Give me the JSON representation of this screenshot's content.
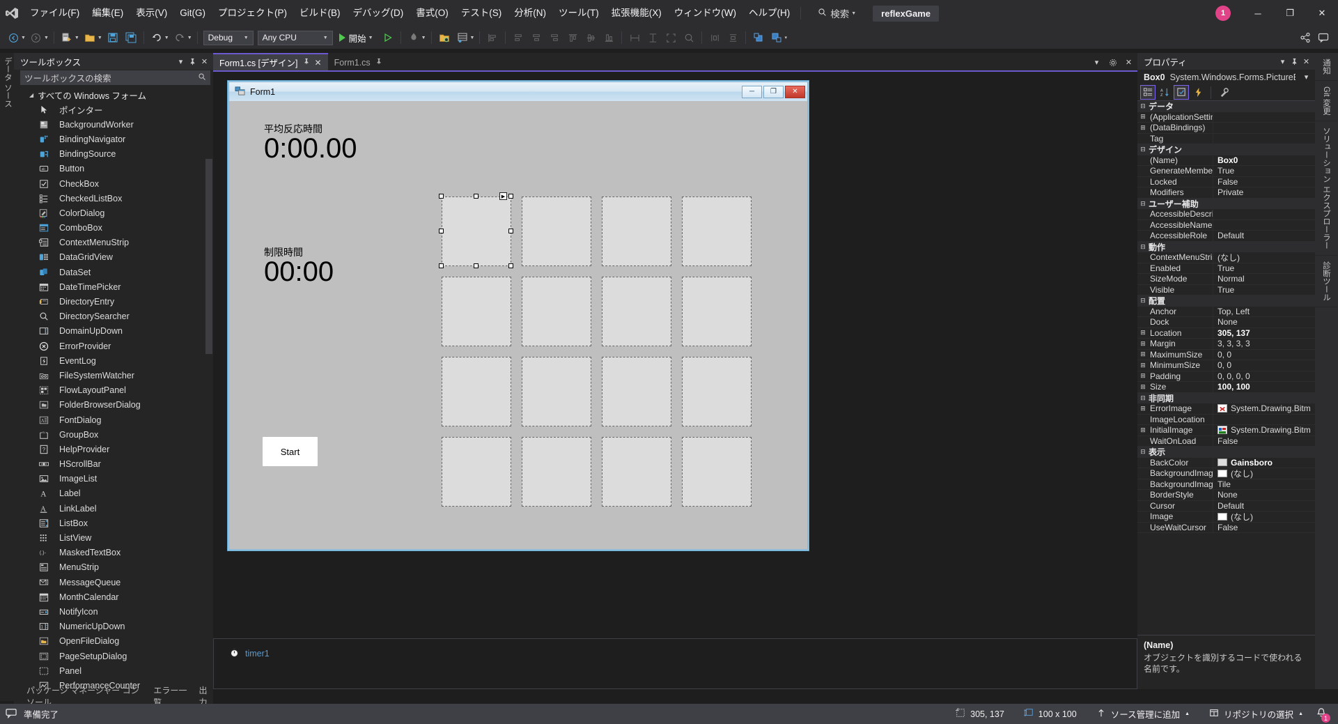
{
  "titlebar": {
    "logo_icon": "visual-studio-logo-icon",
    "menus": [
      "ファイル(F)",
      "編集(E)",
      "表示(V)",
      "Git(G)",
      "プロジェクト(P)",
      "ビルド(B)",
      "デバッグ(D)",
      "書式(O)",
      "テスト(S)",
      "分析(N)",
      "ツール(T)",
      "拡張機能(X)",
      "ウィンドウ(W)",
      "ヘルプ(H)"
    ],
    "search_label": "検索",
    "search_icon": "search-icon",
    "project_chip": "reflexGame",
    "notification_count": "1",
    "minimize_label": "─",
    "maximize_label": "❐",
    "close_label": "✕"
  },
  "toolbar": {
    "configuration": "Debug",
    "platform": "Any CPU",
    "run_label": "開始",
    "icons": [
      "back-navigate-icon",
      "forward-navigate-icon",
      "new-project-icon",
      "open-file-icon",
      "save-icon",
      "save-all-icon",
      "undo-icon",
      "redo-icon",
      "start-debug-icon",
      "attach-process-icon",
      "hot-reload-icon",
      "solution-explorer-icon",
      "properties-window-icon"
    ]
  },
  "left_vertical_tabs": [
    "データ ソース"
  ],
  "toolbox": {
    "title": "ツールボックス",
    "dropdown_icon": "chevron-down-icon",
    "pin_icon": "pin-icon",
    "close_icon": "close-icon",
    "search_placeholder": "ツールボックスの検索",
    "search_icon": "search-icon",
    "group_label": "すべての Windows フォーム",
    "group_expander": "▲",
    "items": [
      {
        "label": "ポインター",
        "icon": "pointer-icon"
      },
      {
        "label": "BackgroundWorker",
        "icon": "background-worker-icon"
      },
      {
        "label": "BindingNavigator",
        "icon": "binding-navigator-icon"
      },
      {
        "label": "BindingSource",
        "icon": "binding-source-icon"
      },
      {
        "label": "Button",
        "icon": "button-icon"
      },
      {
        "label": "CheckBox",
        "icon": "checkbox-icon"
      },
      {
        "label": "CheckedListBox",
        "icon": "checked-list-box-icon"
      },
      {
        "label": "ColorDialog",
        "icon": "color-dialog-icon"
      },
      {
        "label": "ComboBox",
        "icon": "combo-box-icon"
      },
      {
        "label": "ContextMenuStrip",
        "icon": "context-menu-strip-icon"
      },
      {
        "label": "DataGridView",
        "icon": "data-grid-view-icon"
      },
      {
        "label": "DataSet",
        "icon": "data-set-icon"
      },
      {
        "label": "DateTimePicker",
        "icon": "date-time-picker-icon"
      },
      {
        "label": "DirectoryEntry",
        "icon": "directory-entry-icon"
      },
      {
        "label": "DirectorySearcher",
        "icon": "directory-searcher-icon"
      },
      {
        "label": "DomainUpDown",
        "icon": "domain-up-down-icon"
      },
      {
        "label": "ErrorProvider",
        "icon": "error-provider-icon"
      },
      {
        "label": "EventLog",
        "icon": "event-log-icon"
      },
      {
        "label": "FileSystemWatcher",
        "icon": "file-system-watcher-icon"
      },
      {
        "label": "FlowLayoutPanel",
        "icon": "flow-layout-panel-icon"
      },
      {
        "label": "FolderBrowserDialog",
        "icon": "folder-browser-dialog-icon"
      },
      {
        "label": "FontDialog",
        "icon": "font-dialog-icon"
      },
      {
        "label": "GroupBox",
        "icon": "group-box-icon"
      },
      {
        "label": "HelpProvider",
        "icon": "help-provider-icon"
      },
      {
        "label": "HScrollBar",
        "icon": "h-scroll-bar-icon"
      },
      {
        "label": "ImageList",
        "icon": "image-list-icon"
      },
      {
        "label": "Label",
        "icon": "label-icon"
      },
      {
        "label": "LinkLabel",
        "icon": "link-label-icon"
      },
      {
        "label": "ListBox",
        "icon": "list-box-icon"
      },
      {
        "label": "ListView",
        "icon": "list-view-icon"
      },
      {
        "label": "MaskedTextBox",
        "icon": "masked-text-box-icon"
      },
      {
        "label": "MenuStrip",
        "icon": "menu-strip-icon"
      },
      {
        "label": "MessageQueue",
        "icon": "message-queue-icon"
      },
      {
        "label": "MonthCalendar",
        "icon": "month-calendar-icon"
      },
      {
        "label": "NotifyIcon",
        "icon": "notify-icon-icon"
      },
      {
        "label": "NumericUpDown",
        "icon": "numeric-up-down-icon"
      },
      {
        "label": "OpenFileDialog",
        "icon": "open-file-dialog-icon"
      },
      {
        "label": "PageSetupDialog",
        "icon": "page-setup-dialog-icon"
      },
      {
        "label": "Panel",
        "icon": "panel-icon"
      },
      {
        "label": "PerformanceCounter",
        "icon": "performance-counter-icon"
      }
    ],
    "bottom_tabs": [
      "パッケージ マネージャー コンソール",
      "エラー一覧",
      "出力"
    ]
  },
  "document_tabs": [
    {
      "label": "Form1.cs [デザイン]",
      "active": true,
      "pin_icon": "pin-icon",
      "close_icon": "close-icon"
    },
    {
      "label": "Form1.cs",
      "active": false,
      "pin_icon": "pin-icon",
      "close_icon": ""
    }
  ],
  "designer": {
    "form": {
      "title": "Form1",
      "icon": "form-icon",
      "minimize_label": "─",
      "maximize_label": "❐",
      "close_label": "✕",
      "labels": [
        {
          "name": "avg-reaction-caption",
          "text": "平均反応時間"
        },
        {
          "name": "avg-reaction-value",
          "text": "0:00.00"
        },
        {
          "name": "time-limit-caption",
          "text": "制限時間"
        },
        {
          "name": "time-limit-value",
          "text": "00:00"
        }
      ],
      "start_button": "Start",
      "grid_rows": 4,
      "grid_cols": 4,
      "selected_box": "Box0"
    }
  },
  "tray": {
    "items": [
      {
        "label": "timer1",
        "icon": "timer-icon"
      }
    ]
  },
  "properties": {
    "title": "プロパティ",
    "dropdown_icon": "chevron-down-icon",
    "pin_icon": "pin-icon",
    "close_icon": "close-icon",
    "object_name": "Box0",
    "object_type": "System.Windows.Forms.PictureBox",
    "object_dropdown_icon": "chevron-down-icon",
    "toolbar_icons": [
      "categorized-view-icon",
      "alphabetical-view-icon",
      "properties-page-icon",
      "events-icon",
      "property-pages-icon"
    ],
    "rows": [
      {
        "kind": "cat",
        "name": "データ"
      },
      {
        "kind": "prop",
        "exp": "+",
        "name": "(ApplicationSettings",
        "value": ""
      },
      {
        "kind": "prop",
        "exp": "+",
        "name": "(DataBindings)",
        "value": ""
      },
      {
        "kind": "prop",
        "exp": "",
        "name": "Tag",
        "value": ""
      },
      {
        "kind": "cat",
        "name": "デザイン"
      },
      {
        "kind": "prop",
        "exp": "",
        "name": "(Name)",
        "value": "Box0",
        "bold": true
      },
      {
        "kind": "prop",
        "exp": "",
        "name": "GenerateMember",
        "value": "True"
      },
      {
        "kind": "prop",
        "exp": "",
        "name": "Locked",
        "value": "False"
      },
      {
        "kind": "prop",
        "exp": "",
        "name": "Modifiers",
        "value": "Private"
      },
      {
        "kind": "cat",
        "name": "ユーザー補助"
      },
      {
        "kind": "prop",
        "exp": "",
        "name": "AccessibleDescriptio",
        "value": ""
      },
      {
        "kind": "prop",
        "exp": "",
        "name": "AccessibleName",
        "value": ""
      },
      {
        "kind": "prop",
        "exp": "",
        "name": "AccessibleRole",
        "value": "Default"
      },
      {
        "kind": "cat",
        "name": "動作"
      },
      {
        "kind": "prop",
        "exp": "",
        "name": "ContextMenuStrip",
        "value": "(なし)"
      },
      {
        "kind": "prop",
        "exp": "",
        "name": "Enabled",
        "value": "True"
      },
      {
        "kind": "prop",
        "exp": "",
        "name": "SizeMode",
        "value": "Normal"
      },
      {
        "kind": "prop",
        "exp": "",
        "name": "Visible",
        "value": "True"
      },
      {
        "kind": "cat",
        "name": "配置"
      },
      {
        "kind": "prop",
        "exp": "",
        "name": "Anchor",
        "value": "Top, Left"
      },
      {
        "kind": "prop",
        "exp": "",
        "name": "Dock",
        "value": "None"
      },
      {
        "kind": "prop",
        "exp": "+",
        "name": "Location",
        "value": "305, 137",
        "bold": true
      },
      {
        "kind": "prop",
        "exp": "+",
        "name": "Margin",
        "value": "3, 3, 3, 3"
      },
      {
        "kind": "prop",
        "exp": "+",
        "name": "MaximumSize",
        "value": "0, 0"
      },
      {
        "kind": "prop",
        "exp": "+",
        "name": "MinimumSize",
        "value": "0, 0"
      },
      {
        "kind": "prop",
        "exp": "+",
        "name": "Padding",
        "value": "0, 0, 0, 0"
      },
      {
        "kind": "prop",
        "exp": "+",
        "name": "Size",
        "value": "100, 100",
        "bold": true
      },
      {
        "kind": "cat",
        "name": "非同期"
      },
      {
        "kind": "prop",
        "exp": "+",
        "name": "ErrorImage",
        "value": "System.Drawing.Bitm",
        "img": "error-image-thumb"
      },
      {
        "kind": "prop",
        "exp": "",
        "name": "ImageLocation",
        "value": ""
      },
      {
        "kind": "prop",
        "exp": "+",
        "name": "InitialImage",
        "value": "System.Drawing.Bitm",
        "img": "initial-image-thumb"
      },
      {
        "kind": "prop",
        "exp": "",
        "name": "WaitOnLoad",
        "value": "False"
      },
      {
        "kind": "cat",
        "name": "表示"
      },
      {
        "kind": "prop",
        "exp": "",
        "name": "BackColor",
        "value": "Gainsboro",
        "swatch": "#dcdcdc",
        "bold": true
      },
      {
        "kind": "prop",
        "exp": "",
        "name": "BackgroundImage",
        "value": "(なし)",
        "swatch": "#ffffff"
      },
      {
        "kind": "prop",
        "exp": "",
        "name": "BackgroundImageLa",
        "value": "Tile"
      },
      {
        "kind": "prop",
        "exp": "",
        "name": "BorderStyle",
        "value": "None"
      },
      {
        "kind": "prop",
        "exp": "",
        "name": "Cursor",
        "value": "Default"
      },
      {
        "kind": "prop",
        "exp": "",
        "name": "Image",
        "value": "(なし)",
        "swatch": "#ffffff"
      },
      {
        "kind": "prop",
        "exp": "",
        "name": "UseWaitCursor",
        "value": "False"
      }
    ],
    "desc_title": "(Name)",
    "desc_text": "オブジェクトを識別するコードで使われる名前です。"
  },
  "right_vertical_tabs": [
    "通知",
    "Git 変更",
    "ソリューション エクスプローラー",
    "診断ツール"
  ],
  "statusbar": {
    "ready_text": "準備完了",
    "ready_icon": "ready-icon",
    "location": "305, 137",
    "location_icon": "position-icon",
    "size": "100 x 100",
    "size_icon": "size-icon",
    "source_control": "ソース管理に追加",
    "source_control_icon": "arrow-up-icon",
    "repository": "リポジトリの選択",
    "repository_icon": "repository-icon",
    "notification_count": "1",
    "notification_icon": "bell-icon",
    "caret": "▲"
  }
}
